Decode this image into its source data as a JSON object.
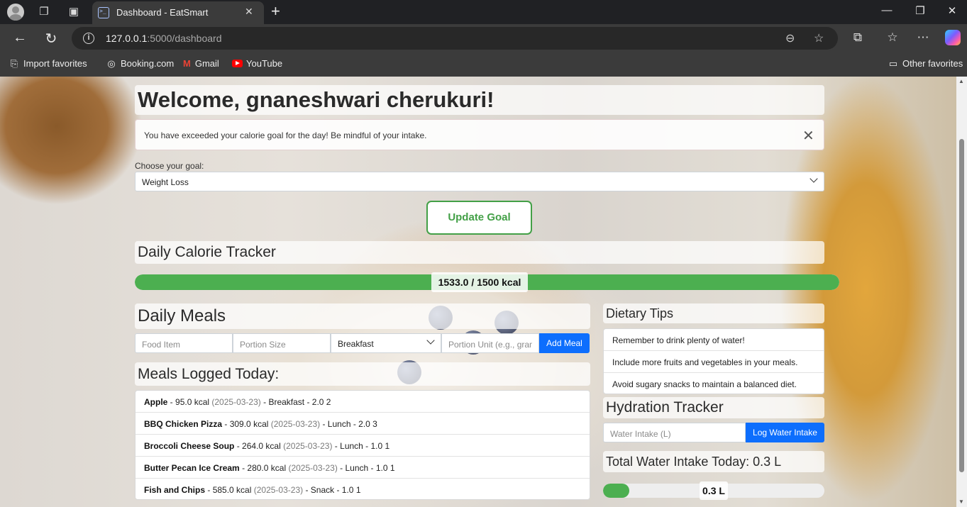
{
  "browser": {
    "tab_title": "Dashboard - EatSmart",
    "url_host": "127.0.0.1",
    "url_path": ":5000/dashboard",
    "favorites": [
      "Import favorites",
      "Booking.com",
      "Gmail",
      "YouTube"
    ],
    "other_favorites": "Other favorites"
  },
  "page": {
    "welcome": "Welcome, gnaneshwari cherukuri!",
    "alert_text": "You have exceeded your calorie goal for the day! Be mindful of your intake.",
    "goal_label": "Choose your goal:",
    "goal_value": "Weight Loss",
    "update_goal_label": "Update Goal",
    "calorie_title": "Daily Calorie Tracker",
    "calorie_consumed": 1533.0,
    "calorie_goal": 1500,
    "calorie_label": "1533.0 / 1500 kcal",
    "meals_title": "Daily Meals",
    "food_placeholder": "Food Item",
    "portion_placeholder": "Portion Size",
    "meal_type_value": "Breakfast",
    "unit_placeholder": "Portion Unit (e.g., grams)",
    "add_meal_label": "Add Meal",
    "logged_title": "Meals Logged Today:",
    "meals": [
      {
        "name": "Apple",
        "kcal": "95.0 kcal",
        "date": "(2025-03-23)",
        "meta": "Breakfast - 2.0 2"
      },
      {
        "name": "BBQ Chicken Pizza",
        "kcal": "309.0 kcal",
        "date": "(2025-03-23)",
        "meta": "Lunch - 2.0 3"
      },
      {
        "name": "Broccoli Cheese Soup",
        "kcal": "264.0 kcal",
        "date": "(2025-03-23)",
        "meta": "Lunch - 1.0 1"
      },
      {
        "name": "Butter Pecan Ice Cream",
        "kcal": "280.0 kcal",
        "date": "(2025-03-23)",
        "meta": "Lunch - 1.0 1"
      },
      {
        "name": "Fish and Chips",
        "kcal": "585.0 kcal",
        "date": "(2025-03-23)",
        "meta": "Snack - 1.0 1"
      }
    ],
    "tips_title": "Dietary Tips",
    "tips": [
      "Remember to drink plenty of water!",
      "Include more fruits and vegetables in your meals.",
      "Avoid sugary snacks to maintain a balanced diet."
    ],
    "hydration_title": "Hydration Tracker",
    "water_placeholder": "Water Intake (L)",
    "log_water_label": "Log Water Intake",
    "total_water_title": "Total Water Intake Today: 0.3 L",
    "water_label": "0.3 L",
    "water_fraction": 0.12
  },
  "colors": {
    "accent_green": "#4caf50",
    "primary_blue": "#0d6efd"
  }
}
